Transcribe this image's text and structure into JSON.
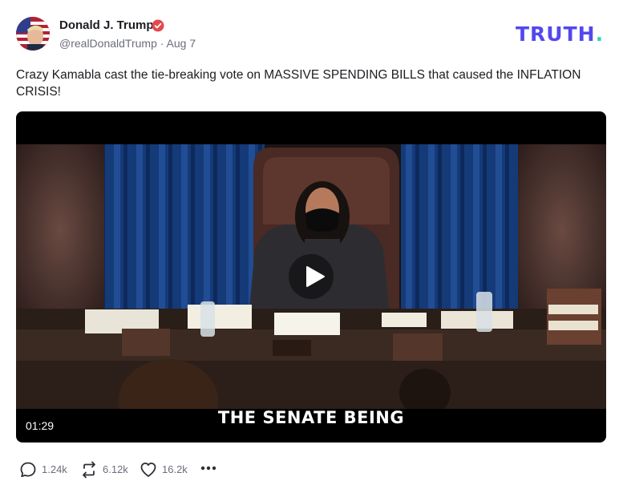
{
  "author": {
    "name": "Donald J. Trump",
    "handle": "@realDonaldTrump",
    "separator": "·",
    "date": "Aug 7"
  },
  "brand": {
    "logo_text": "TRUTH",
    "logo_dot": "."
  },
  "post": {
    "text": "Crazy Kamabla cast the tie-breaking vote on MASSIVE SPENDING BILLS that caused the INFLATION CRISIS!"
  },
  "video": {
    "caption": "THE SENATE BEING",
    "duration": "01:29"
  },
  "actions": {
    "replies": "1.24k",
    "retruths": "6.12k",
    "likes": "16.2k"
  },
  "colors": {
    "brand": "#5448ee",
    "brand_accent": "#2ad7b8",
    "verified": "#e5484d",
    "muted_text": "#6b6e7d"
  },
  "icons": [
    "verified-icon",
    "play-icon",
    "reply-icon",
    "retruth-icon",
    "like-icon",
    "more-icon"
  ]
}
